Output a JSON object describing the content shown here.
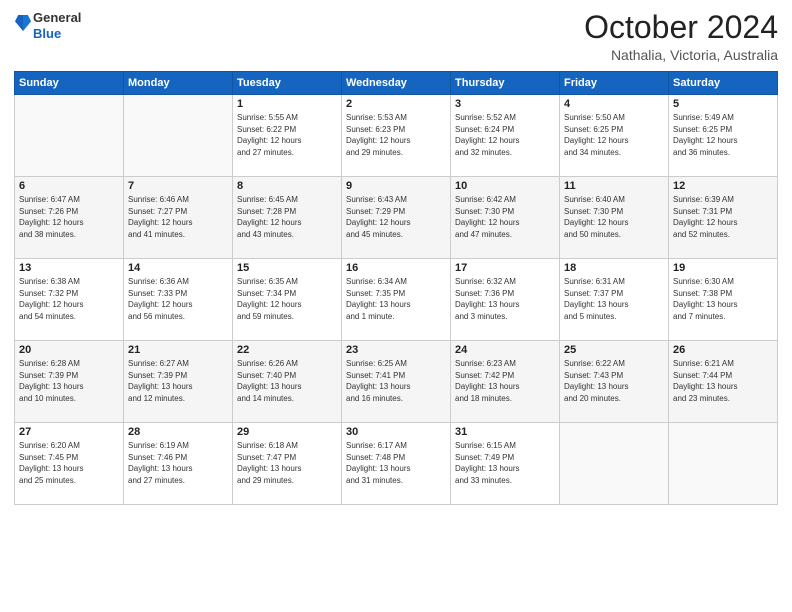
{
  "logo": {
    "general": "General",
    "blue": "Blue"
  },
  "header": {
    "month": "October 2024",
    "location": "Nathalia, Victoria, Australia"
  },
  "weekdays": [
    "Sunday",
    "Monday",
    "Tuesday",
    "Wednesday",
    "Thursday",
    "Friday",
    "Saturday"
  ],
  "weeks": [
    [
      {
        "day": "",
        "info": ""
      },
      {
        "day": "",
        "info": ""
      },
      {
        "day": "1",
        "info": "Sunrise: 5:55 AM\nSunset: 6:22 PM\nDaylight: 12 hours\nand 27 minutes."
      },
      {
        "day": "2",
        "info": "Sunrise: 5:53 AM\nSunset: 6:23 PM\nDaylight: 12 hours\nand 29 minutes."
      },
      {
        "day": "3",
        "info": "Sunrise: 5:52 AM\nSunset: 6:24 PM\nDaylight: 12 hours\nand 32 minutes."
      },
      {
        "day": "4",
        "info": "Sunrise: 5:50 AM\nSunset: 6:25 PM\nDaylight: 12 hours\nand 34 minutes."
      },
      {
        "day": "5",
        "info": "Sunrise: 5:49 AM\nSunset: 6:25 PM\nDaylight: 12 hours\nand 36 minutes."
      }
    ],
    [
      {
        "day": "6",
        "info": "Sunrise: 6:47 AM\nSunset: 7:26 PM\nDaylight: 12 hours\nand 38 minutes."
      },
      {
        "day": "7",
        "info": "Sunrise: 6:46 AM\nSunset: 7:27 PM\nDaylight: 12 hours\nand 41 minutes."
      },
      {
        "day": "8",
        "info": "Sunrise: 6:45 AM\nSunset: 7:28 PM\nDaylight: 12 hours\nand 43 minutes."
      },
      {
        "day": "9",
        "info": "Sunrise: 6:43 AM\nSunset: 7:29 PM\nDaylight: 12 hours\nand 45 minutes."
      },
      {
        "day": "10",
        "info": "Sunrise: 6:42 AM\nSunset: 7:30 PM\nDaylight: 12 hours\nand 47 minutes."
      },
      {
        "day": "11",
        "info": "Sunrise: 6:40 AM\nSunset: 7:30 PM\nDaylight: 12 hours\nand 50 minutes."
      },
      {
        "day": "12",
        "info": "Sunrise: 6:39 AM\nSunset: 7:31 PM\nDaylight: 12 hours\nand 52 minutes."
      }
    ],
    [
      {
        "day": "13",
        "info": "Sunrise: 6:38 AM\nSunset: 7:32 PM\nDaylight: 12 hours\nand 54 minutes."
      },
      {
        "day": "14",
        "info": "Sunrise: 6:36 AM\nSunset: 7:33 PM\nDaylight: 12 hours\nand 56 minutes."
      },
      {
        "day": "15",
        "info": "Sunrise: 6:35 AM\nSunset: 7:34 PM\nDaylight: 12 hours\nand 59 minutes."
      },
      {
        "day": "16",
        "info": "Sunrise: 6:34 AM\nSunset: 7:35 PM\nDaylight: 13 hours\nand 1 minute."
      },
      {
        "day": "17",
        "info": "Sunrise: 6:32 AM\nSunset: 7:36 PM\nDaylight: 13 hours\nand 3 minutes."
      },
      {
        "day": "18",
        "info": "Sunrise: 6:31 AM\nSunset: 7:37 PM\nDaylight: 13 hours\nand 5 minutes."
      },
      {
        "day": "19",
        "info": "Sunrise: 6:30 AM\nSunset: 7:38 PM\nDaylight: 13 hours\nand 7 minutes."
      }
    ],
    [
      {
        "day": "20",
        "info": "Sunrise: 6:28 AM\nSunset: 7:39 PM\nDaylight: 13 hours\nand 10 minutes."
      },
      {
        "day": "21",
        "info": "Sunrise: 6:27 AM\nSunset: 7:39 PM\nDaylight: 13 hours\nand 12 minutes."
      },
      {
        "day": "22",
        "info": "Sunrise: 6:26 AM\nSunset: 7:40 PM\nDaylight: 13 hours\nand 14 minutes."
      },
      {
        "day": "23",
        "info": "Sunrise: 6:25 AM\nSunset: 7:41 PM\nDaylight: 13 hours\nand 16 minutes."
      },
      {
        "day": "24",
        "info": "Sunrise: 6:23 AM\nSunset: 7:42 PM\nDaylight: 13 hours\nand 18 minutes."
      },
      {
        "day": "25",
        "info": "Sunrise: 6:22 AM\nSunset: 7:43 PM\nDaylight: 13 hours\nand 20 minutes."
      },
      {
        "day": "26",
        "info": "Sunrise: 6:21 AM\nSunset: 7:44 PM\nDaylight: 13 hours\nand 23 minutes."
      }
    ],
    [
      {
        "day": "27",
        "info": "Sunrise: 6:20 AM\nSunset: 7:45 PM\nDaylight: 13 hours\nand 25 minutes."
      },
      {
        "day": "28",
        "info": "Sunrise: 6:19 AM\nSunset: 7:46 PM\nDaylight: 13 hours\nand 27 minutes."
      },
      {
        "day": "29",
        "info": "Sunrise: 6:18 AM\nSunset: 7:47 PM\nDaylight: 13 hours\nand 29 minutes."
      },
      {
        "day": "30",
        "info": "Sunrise: 6:17 AM\nSunset: 7:48 PM\nDaylight: 13 hours\nand 31 minutes."
      },
      {
        "day": "31",
        "info": "Sunrise: 6:15 AM\nSunset: 7:49 PM\nDaylight: 13 hours\nand 33 minutes."
      },
      {
        "day": "",
        "info": ""
      },
      {
        "day": "",
        "info": ""
      }
    ]
  ]
}
